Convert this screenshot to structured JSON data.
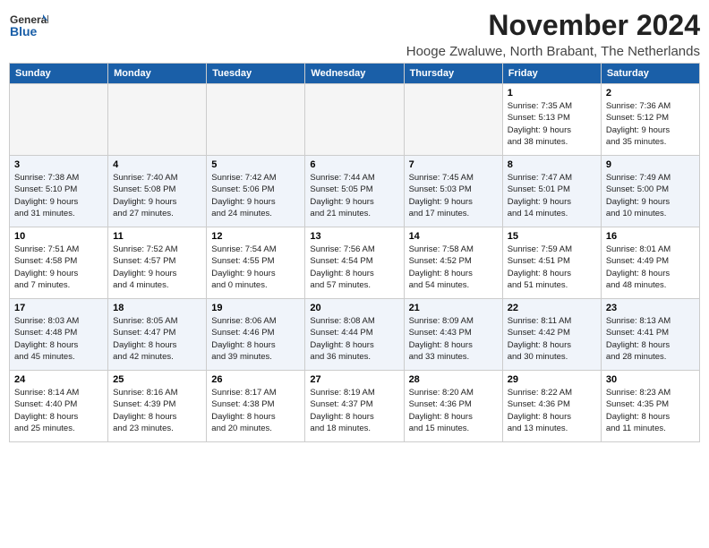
{
  "header": {
    "logo_general": "General",
    "logo_blue": "Blue",
    "month_title": "November 2024",
    "location": "Hooge Zwaluwe, North Brabant, The Netherlands"
  },
  "weekdays": [
    "Sunday",
    "Monday",
    "Tuesday",
    "Wednesday",
    "Thursday",
    "Friday",
    "Saturday"
  ],
  "weeks": [
    [
      {
        "day": "",
        "info": ""
      },
      {
        "day": "",
        "info": ""
      },
      {
        "day": "",
        "info": ""
      },
      {
        "day": "",
        "info": ""
      },
      {
        "day": "",
        "info": ""
      },
      {
        "day": "1",
        "info": "Sunrise: 7:35 AM\nSunset: 5:13 PM\nDaylight: 9 hours\nand 38 minutes."
      },
      {
        "day": "2",
        "info": "Sunrise: 7:36 AM\nSunset: 5:12 PM\nDaylight: 9 hours\nand 35 minutes."
      }
    ],
    [
      {
        "day": "3",
        "info": "Sunrise: 7:38 AM\nSunset: 5:10 PM\nDaylight: 9 hours\nand 31 minutes."
      },
      {
        "day": "4",
        "info": "Sunrise: 7:40 AM\nSunset: 5:08 PM\nDaylight: 9 hours\nand 27 minutes."
      },
      {
        "day": "5",
        "info": "Sunrise: 7:42 AM\nSunset: 5:06 PM\nDaylight: 9 hours\nand 24 minutes."
      },
      {
        "day": "6",
        "info": "Sunrise: 7:44 AM\nSunset: 5:05 PM\nDaylight: 9 hours\nand 21 minutes."
      },
      {
        "day": "7",
        "info": "Sunrise: 7:45 AM\nSunset: 5:03 PM\nDaylight: 9 hours\nand 17 minutes."
      },
      {
        "day": "8",
        "info": "Sunrise: 7:47 AM\nSunset: 5:01 PM\nDaylight: 9 hours\nand 14 minutes."
      },
      {
        "day": "9",
        "info": "Sunrise: 7:49 AM\nSunset: 5:00 PM\nDaylight: 9 hours\nand 10 minutes."
      }
    ],
    [
      {
        "day": "10",
        "info": "Sunrise: 7:51 AM\nSunset: 4:58 PM\nDaylight: 9 hours\nand 7 minutes."
      },
      {
        "day": "11",
        "info": "Sunrise: 7:52 AM\nSunset: 4:57 PM\nDaylight: 9 hours\nand 4 minutes."
      },
      {
        "day": "12",
        "info": "Sunrise: 7:54 AM\nSunset: 4:55 PM\nDaylight: 9 hours\nand 0 minutes."
      },
      {
        "day": "13",
        "info": "Sunrise: 7:56 AM\nSunset: 4:54 PM\nDaylight: 8 hours\nand 57 minutes."
      },
      {
        "day": "14",
        "info": "Sunrise: 7:58 AM\nSunset: 4:52 PM\nDaylight: 8 hours\nand 54 minutes."
      },
      {
        "day": "15",
        "info": "Sunrise: 7:59 AM\nSunset: 4:51 PM\nDaylight: 8 hours\nand 51 minutes."
      },
      {
        "day": "16",
        "info": "Sunrise: 8:01 AM\nSunset: 4:49 PM\nDaylight: 8 hours\nand 48 minutes."
      }
    ],
    [
      {
        "day": "17",
        "info": "Sunrise: 8:03 AM\nSunset: 4:48 PM\nDaylight: 8 hours\nand 45 minutes."
      },
      {
        "day": "18",
        "info": "Sunrise: 8:05 AM\nSunset: 4:47 PM\nDaylight: 8 hours\nand 42 minutes."
      },
      {
        "day": "19",
        "info": "Sunrise: 8:06 AM\nSunset: 4:46 PM\nDaylight: 8 hours\nand 39 minutes."
      },
      {
        "day": "20",
        "info": "Sunrise: 8:08 AM\nSunset: 4:44 PM\nDaylight: 8 hours\nand 36 minutes."
      },
      {
        "day": "21",
        "info": "Sunrise: 8:09 AM\nSunset: 4:43 PM\nDaylight: 8 hours\nand 33 minutes."
      },
      {
        "day": "22",
        "info": "Sunrise: 8:11 AM\nSunset: 4:42 PM\nDaylight: 8 hours\nand 30 minutes."
      },
      {
        "day": "23",
        "info": "Sunrise: 8:13 AM\nSunset: 4:41 PM\nDaylight: 8 hours\nand 28 minutes."
      }
    ],
    [
      {
        "day": "24",
        "info": "Sunrise: 8:14 AM\nSunset: 4:40 PM\nDaylight: 8 hours\nand 25 minutes."
      },
      {
        "day": "25",
        "info": "Sunrise: 8:16 AM\nSunset: 4:39 PM\nDaylight: 8 hours\nand 23 minutes."
      },
      {
        "day": "26",
        "info": "Sunrise: 8:17 AM\nSunset: 4:38 PM\nDaylight: 8 hours\nand 20 minutes."
      },
      {
        "day": "27",
        "info": "Sunrise: 8:19 AM\nSunset: 4:37 PM\nDaylight: 8 hours\nand 18 minutes."
      },
      {
        "day": "28",
        "info": "Sunrise: 8:20 AM\nSunset: 4:36 PM\nDaylight: 8 hours\nand 15 minutes."
      },
      {
        "day": "29",
        "info": "Sunrise: 8:22 AM\nSunset: 4:36 PM\nDaylight: 8 hours\nand 13 minutes."
      },
      {
        "day": "30",
        "info": "Sunrise: 8:23 AM\nSunset: 4:35 PM\nDaylight: 8 hours\nand 11 minutes."
      }
    ]
  ]
}
